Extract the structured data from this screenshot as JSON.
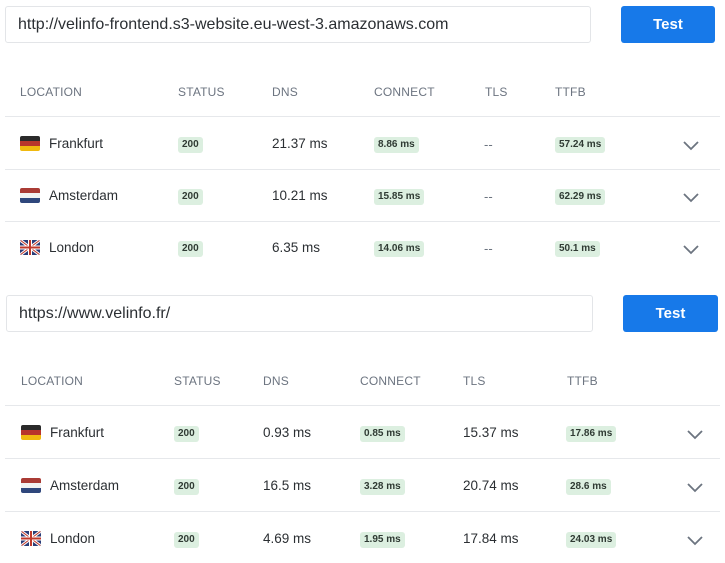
{
  "columns": [
    "LOCATION",
    "STATUS",
    "DNS",
    "CONNECT",
    "TLS",
    "TTFB"
  ],
  "test_label": "Test",
  "tests": [
    {
      "url": "http://velinfo-frontend.s3-website.eu-west-3.amazonaws.com",
      "rows": [
        {
          "location": "Frankfurt",
          "flag": "germany-flag",
          "status": "200",
          "dns": "21.37 ms",
          "connect": "8.86 ms",
          "tls": "--",
          "ttfb": "57.24 ms"
        },
        {
          "location": "Amsterdam",
          "flag": "netherlands-flag",
          "status": "200",
          "dns": "10.21 ms",
          "connect": "15.85 ms",
          "tls": "--",
          "ttfb": "62.29 ms"
        },
        {
          "location": "London",
          "flag": "uk-flag",
          "status": "200",
          "dns": "6.35 ms",
          "connect": "14.06 ms",
          "tls": "--",
          "ttfb": "50.1 ms"
        }
      ]
    },
    {
      "url": "https://www.velinfo.fr/",
      "rows": [
        {
          "location": "Frankfurt",
          "flag": "germany-flag",
          "status": "200",
          "dns": "0.93 ms",
          "connect": "0.85 ms",
          "tls": "15.37 ms",
          "ttfb": "17.86 ms"
        },
        {
          "location": "Amsterdam",
          "flag": "netherlands-flag",
          "status": "200",
          "dns": "16.5 ms",
          "connect": "3.28 ms",
          "tls": "20.74 ms",
          "ttfb": "28.6 ms"
        },
        {
          "location": "London",
          "flag": "uk-flag",
          "status": "200",
          "dns": "4.69 ms",
          "connect": "1.95 ms",
          "tls": "17.84 ms",
          "ttfb": "24.03 ms"
        }
      ]
    }
  ],
  "colors": {
    "button": "#1779e9",
    "badge_bg": "#dcefe0"
  }
}
